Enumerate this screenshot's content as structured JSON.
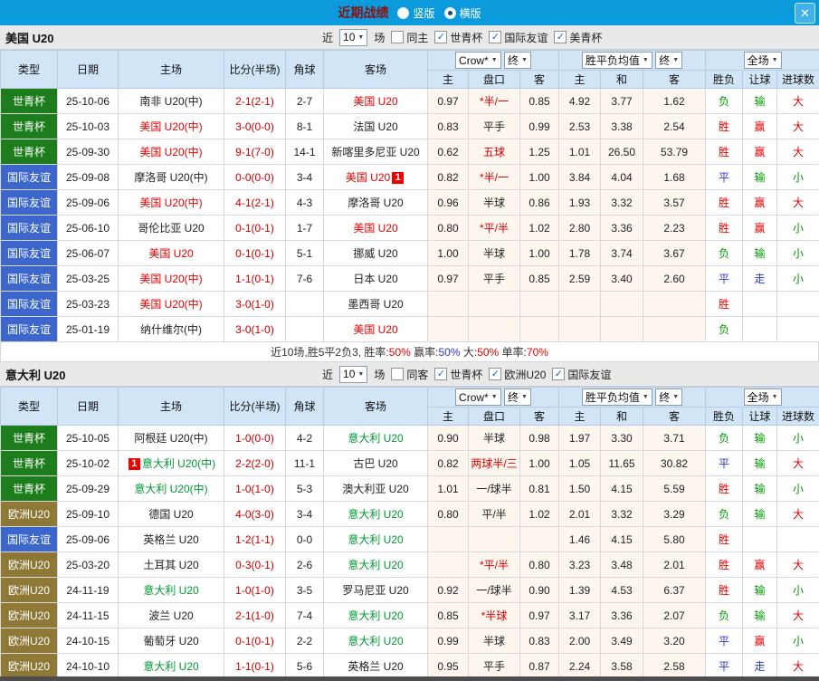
{
  "icons": {
    "dropdown_arrow": "▼",
    "close": "✕",
    "check": "✓"
  },
  "colors": {
    "titlebar_bg": "#0b9bdc",
    "title_text": "#8b1111",
    "header_bg": "#d2e5f6",
    "score_text": "#cc0000",
    "handicap_red": "#d90000",
    "type_colors": {
      "g": "#1d7d1d",
      "b": "#3c66cc",
      "o": "#8d7836"
    },
    "result_colors": {
      "r": "#e60000",
      "g": "#009900",
      "b": "#2a35cc",
      "k": "#333333"
    },
    "summary_colors": {
      "k": "#333333",
      "r": "#e60000",
      "b": "#2a35cc"
    },
    "focus_home": "#e60000",
    "focus_away": "#009933"
  },
  "titlebar": {
    "title": "近期战绩",
    "radio_vertical": "竖版",
    "vertical_selected": false,
    "radio_horizontal": "横版",
    "horizontal_selected": true
  },
  "table_header": {
    "cols": [
      "类型",
      "日期",
      "主场",
      "比分(半场)",
      "角球",
      "客场"
    ],
    "g1a": "Crow*",
    "g1b": "终",
    "g2a": "胜平负均值",
    "g2b": "终",
    "g3": "全场",
    "sub": [
      "主",
      "盘口",
      "客",
      "主",
      "和",
      "客",
      "胜负",
      "让球",
      "进球数"
    ]
  },
  "sections": [
    {
      "team": "美国 U20",
      "focus_color": "#e60000",
      "filter": {
        "near": "近",
        "count": "10",
        "games": "场",
        "checkboxes": [
          {
            "label": "同主",
            "checked": false
          },
          {
            "label": "世青杯",
            "checked": true
          },
          {
            "label": "国际友谊",
            "checked": true
          },
          {
            "label": "美青杯",
            "checked": true
          }
        ]
      },
      "rows": [
        {
          "type": "世青杯",
          "tc": "g",
          "date": "25-10-06",
          "home": "南非 U20(中)",
          "hf": false,
          "hb": "",
          "score": "2-1(2-1)",
          "corner": "2-7",
          "away": "美国 U20",
          "af": true,
          "ab": "",
          "o1": "0.97",
          "h": "*半/一",
          "hr": true,
          "o2": "0.85",
          "m1": "4.92",
          "m2": "3.77",
          "m3": "1.62",
          "r1": "负",
          "c1": "g",
          "r2": "输",
          "c2": "g",
          "r3": "大",
          "c3": "r"
        },
        {
          "type": "世青杯",
          "tc": "g",
          "date": "25-10-03",
          "home": "美国 U20(中)",
          "hf": true,
          "hb": "",
          "score": "3-0(0-0)",
          "corner": "8-1",
          "away": "法国 U20",
          "af": false,
          "ab": "",
          "o1": "0.83",
          "h": "平手",
          "hr": false,
          "o2": "0.99",
          "m1": "2.53",
          "m2": "3.38",
          "m3": "2.54",
          "r1": "胜",
          "c1": "r",
          "r2": "赢",
          "c2": "r",
          "r3": "大",
          "c3": "r"
        },
        {
          "type": "世青杯",
          "tc": "g",
          "date": "25-09-30",
          "home": "美国 U20(中)",
          "hf": true,
          "hb": "",
          "score": "9-1(7-0)",
          "corner": "14-1",
          "away": "新喀里多尼亚 U20",
          "af": false,
          "ab": "",
          "o1": "0.62",
          "h": "五球",
          "hr": true,
          "o2": "1.25",
          "m1": "1.01",
          "m2": "26.50",
          "m3": "53.79",
          "r1": "胜",
          "c1": "r",
          "r2": "赢",
          "c2": "r",
          "r3": "大",
          "c3": "r"
        },
        {
          "type": "国际友谊",
          "tc": "b",
          "date": "25-09-08",
          "home": "摩洛哥 U20(中)",
          "hf": false,
          "hb": "",
          "score": "0-0(0-0)",
          "corner": "3-4",
          "away": "美国 U20",
          "af": true,
          "ab": "1",
          "o1": "0.82",
          "h": "*半/一",
          "hr": true,
          "o2": "1.00",
          "m1": "3.84",
          "m2": "4.04",
          "m3": "1.68",
          "r1": "平",
          "c1": "b",
          "r2": "输",
          "c2": "g",
          "r3": "小",
          "c3": "g"
        },
        {
          "type": "国际友谊",
          "tc": "b",
          "date": "25-09-06",
          "home": "美国 U20(中)",
          "hf": true,
          "hb": "",
          "score": "4-1(2-1)",
          "corner": "4-3",
          "away": "摩洛哥 U20",
          "af": false,
          "ab": "",
          "o1": "0.96",
          "h": "半球",
          "hr": false,
          "o2": "0.86",
          "m1": "1.93",
          "m2": "3.32",
          "m3": "3.57",
          "r1": "胜",
          "c1": "r",
          "r2": "赢",
          "c2": "r",
          "r3": "大",
          "c3": "r"
        },
        {
          "type": "国际友谊",
          "tc": "b",
          "date": "25-06-10",
          "home": "哥伦比亚 U20",
          "hf": false,
          "hb": "",
          "score": "0-1(0-1)",
          "corner": "1-7",
          "away": "美国 U20",
          "af": true,
          "ab": "",
          "o1": "0.80",
          "h": "*平/半",
          "hr": true,
          "o2": "1.02",
          "m1": "2.80",
          "m2": "3.36",
          "m3": "2.23",
          "r1": "胜",
          "c1": "r",
          "r2": "赢",
          "c2": "r",
          "r3": "小",
          "c3": "g"
        },
        {
          "type": "国际友谊",
          "tc": "b",
          "date": "25-06-07",
          "home": "美国 U20",
          "hf": true,
          "hb": "",
          "score": "0-1(0-1)",
          "corner": "5-1",
          "away": "挪威 U20",
          "af": false,
          "ab": "",
          "o1": "1.00",
          "h": "半球",
          "hr": false,
          "o2": "1.00",
          "m1": "1.78",
          "m2": "3.74",
          "m3": "3.67",
          "r1": "负",
          "c1": "g",
          "r2": "输",
          "c2": "g",
          "r3": "小",
          "c3": "g"
        },
        {
          "type": "国际友谊",
          "tc": "b",
          "date": "25-03-25",
          "home": "美国 U20(中)",
          "hf": true,
          "hb": "",
          "score": "1-1(0-1)",
          "corner": "7-6",
          "away": "日本 U20",
          "af": false,
          "ab": "",
          "o1": "0.97",
          "h": "平手",
          "hr": false,
          "o2": "0.85",
          "m1": "2.59",
          "m2": "3.40",
          "m3": "2.60",
          "r1": "平",
          "c1": "b",
          "r2": "走",
          "c2": "b",
          "r3": "小",
          "c3": "g"
        },
        {
          "type": "国际友谊",
          "tc": "b",
          "date": "25-03-23",
          "home": "美国 U20(中)",
          "hf": true,
          "hb": "",
          "score": "3-0(1-0)",
          "corner": "",
          "away": "墨西哥 U20",
          "af": false,
          "ab": "",
          "o1": "",
          "h": "",
          "hr": false,
          "o2": "",
          "m1": "",
          "m2": "",
          "m3": "",
          "r1": "胜",
          "c1": "r",
          "r2": "",
          "c2": "k",
          "r3": "",
          "c3": "k"
        },
        {
          "type": "国际友谊",
          "tc": "b",
          "date": "25-01-19",
          "home": "纳什维尔(中)",
          "hf": false,
          "hb": "",
          "score": "3-0(1-0)",
          "corner": "",
          "away": "美国 U20",
          "af": true,
          "ab": "",
          "o1": "",
          "h": "",
          "hr": false,
          "o2": "",
          "m1": "",
          "m2": "",
          "m3": "",
          "r1": "负",
          "c1": "g",
          "r2": "",
          "c2": "k",
          "r3": "",
          "c3": "k"
        }
      ],
      "summary": [
        {
          "t": "近10场,胜5平2负3, 胜率:",
          "c": "k"
        },
        {
          "t": "50%",
          "c": "r"
        },
        {
          "t": " 赢率:",
          "c": "k"
        },
        {
          "t": "50%",
          "c": "b"
        },
        {
          "t": " 大:",
          "c": "k"
        },
        {
          "t": "50%",
          "c": "r"
        },
        {
          "t": " 单率:",
          "c": "k"
        },
        {
          "t": "70%",
          "c": "r"
        }
      ]
    },
    {
      "team": "意大利 U20",
      "focus_color": "#009933",
      "filter": {
        "near": "近",
        "count": "10",
        "games": "场",
        "checkboxes": [
          {
            "label": "同客",
            "checked": false
          },
          {
            "label": "世青杯",
            "checked": true
          },
          {
            "label": "欧洲U20",
            "checked": true
          },
          {
            "label": "国际友谊",
            "checked": true
          }
        ]
      },
      "rows": [
        {
          "type": "世青杯",
          "tc": "g",
          "date": "25-10-05",
          "home": "阿根廷 U20(中)",
          "hf": false,
          "hb": "",
          "score": "1-0(0-0)",
          "corner": "4-2",
          "away": "意大利 U20",
          "af": true,
          "ab": "",
          "o1": "0.90",
          "h": "半球",
          "hr": false,
          "o2": "0.98",
          "m1": "1.97",
          "m2": "3.30",
          "m3": "3.71",
          "r1": "负",
          "c1": "g",
          "r2": "输",
          "c2": "g",
          "r3": "小",
          "c3": "g"
        },
        {
          "type": "世青杯",
          "tc": "g",
          "date": "25-10-02",
          "home": "意大利 U20(中)",
          "hf": true,
          "hb": "1",
          "score": "2-2(2-0)",
          "corner": "11-1",
          "away": "古巴 U20",
          "af": false,
          "ab": "",
          "o1": "0.82",
          "h": "两球半/三",
          "hr": true,
          "o2": "1.00",
          "m1": "1.05",
          "m2": "11.65",
          "m3": "30.82",
          "r1": "平",
          "c1": "b",
          "r2": "输",
          "c2": "g",
          "r3": "大",
          "c3": "r"
        },
        {
          "type": "世青杯",
          "tc": "g",
          "date": "25-09-29",
          "home": "意大利 U20(中)",
          "hf": true,
          "hb": "",
          "score": "1-0(1-0)",
          "corner": "5-3",
          "away": "澳大利亚 U20",
          "af": false,
          "ab": "",
          "o1": "1.01",
          "h": "一/球半",
          "hr": false,
          "o2": "0.81",
          "m1": "1.50",
          "m2": "4.15",
          "m3": "5.59",
          "r1": "胜",
          "c1": "r",
          "r2": "输",
          "c2": "g",
          "r3": "小",
          "c3": "g"
        },
        {
          "type": "欧洲U20",
          "tc": "o",
          "date": "25-09-10",
          "home": "德国 U20",
          "hf": false,
          "hb": "",
          "score": "4-0(3-0)",
          "corner": "3-4",
          "away": "意大利 U20",
          "af": true,
          "ab": "",
          "o1": "0.80",
          "h": "平/半",
          "hr": false,
          "o2": "1.02",
          "m1": "2.01",
          "m2": "3.32",
          "m3": "3.29",
          "r1": "负",
          "c1": "g",
          "r2": "输",
          "c2": "g",
          "r3": "大",
          "c3": "r"
        },
        {
          "type": "国际友谊",
          "tc": "b",
          "date": "25-09-06",
          "home": "英格兰 U20",
          "hf": false,
          "hb": "",
          "score": "1-2(1-1)",
          "corner": "0-0",
          "away": "意大利 U20",
          "af": true,
          "ab": "",
          "o1": "",
          "h": "",
          "hr": false,
          "o2": "",
          "m1": "1.46",
          "m2": "4.15",
          "m3": "5.80",
          "r1": "胜",
          "c1": "r",
          "r2": "",
          "c2": "k",
          "r3": "",
          "c3": "k"
        },
        {
          "type": "欧洲U20",
          "tc": "o",
          "date": "25-03-20",
          "home": "土耳其 U20",
          "hf": false,
          "hb": "",
          "score": "0-3(0-1)",
          "corner": "2-6",
          "away": "意大利 U20",
          "af": true,
          "ab": "",
          "o1": "",
          "h": "*平/半",
          "hr": true,
          "o2": "0.80",
          "m1": "3.23",
          "m2": "3.48",
          "m3": "2.01",
          "r1": "胜",
          "c1": "r",
          "r2": "赢",
          "c2": "r",
          "r3": "大",
          "c3": "r"
        },
        {
          "type": "欧洲U20",
          "tc": "o",
          "date": "24-11-19",
          "home": "意大利 U20",
          "hf": true,
          "hb": "",
          "score": "1-0(1-0)",
          "corner": "3-5",
          "away": "罗马尼亚 U20",
          "af": false,
          "ab": "",
          "o1": "0.92",
          "h": "一/球半",
          "hr": false,
          "o2": "0.90",
          "m1": "1.39",
          "m2": "4.53",
          "m3": "6.37",
          "r1": "胜",
          "c1": "r",
          "r2": "输",
          "c2": "g",
          "r3": "小",
          "c3": "g"
        },
        {
          "type": "欧洲U20",
          "tc": "o",
          "date": "24-11-15",
          "home": "波兰 U20",
          "hf": false,
          "hb": "",
          "score": "2-1(1-0)",
          "corner": "7-4",
          "away": "意大利 U20",
          "af": true,
          "ab": "",
          "o1": "0.85",
          "h": "*半球",
          "hr": true,
          "o2": "0.97",
          "m1": "3.17",
          "m2": "3.36",
          "m3": "2.07",
          "r1": "负",
          "c1": "g",
          "r2": "输",
          "c2": "g",
          "r3": "大",
          "c3": "r"
        },
        {
          "type": "欧洲U20",
          "tc": "o",
          "date": "24-10-15",
          "home": "葡萄牙 U20",
          "hf": false,
          "hb": "",
          "score": "0-1(0-1)",
          "corner": "2-2",
          "away": "意大利 U20",
          "af": true,
          "ab": "",
          "o1": "0.99",
          "h": "半球",
          "hr": false,
          "o2": "0.83",
          "m1": "2.00",
          "m2": "3.49",
          "m3": "3.20",
          "r1": "平",
          "c1": "b",
          "r2": "赢",
          "c2": "r",
          "r3": "小",
          "c3": "g"
        },
        {
          "type": "欧洲U20",
          "tc": "o",
          "date": "24-10-10",
          "home": "意大利 U20",
          "hf": true,
          "hb": "",
          "score": "1-1(0-1)",
          "corner": "5-6",
          "away": "英格兰 U20",
          "af": false,
          "ab": "",
          "o1": "0.95",
          "h": "平手",
          "hr": false,
          "o2": "0.87",
          "m1": "2.24",
          "m2": "3.58",
          "m3": "2.58",
          "r1": "平",
          "c1": "b",
          "r2": "走",
          "c2": "b",
          "r3": "大",
          "c3": "r"
        }
      ],
      "summary": null
    }
  ]
}
